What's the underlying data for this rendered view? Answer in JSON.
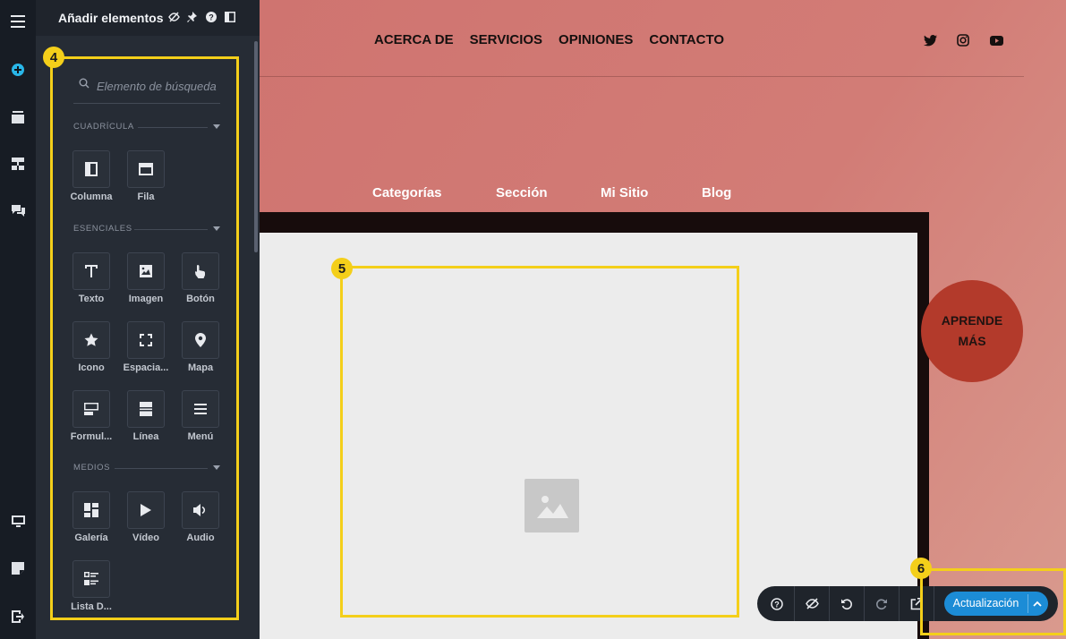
{
  "panel": {
    "title": "Añadir elementos",
    "search_placeholder": "Elemento de búsqueda",
    "sections": [
      {
        "label": "CUADRÍCULA",
        "items": [
          {
            "label": "Columna",
            "icon": "column-icon"
          },
          {
            "label": "Fila",
            "icon": "row-icon"
          }
        ]
      },
      {
        "label": "ESENCIALES",
        "items": [
          {
            "label": "Texto",
            "icon": "text-icon"
          },
          {
            "label": "Imagen",
            "icon": "image-icon"
          },
          {
            "label": "Botón",
            "icon": "pointer-hand-icon"
          },
          {
            "label": "Icono",
            "icon": "star-icon"
          },
          {
            "label": "Espacia...",
            "icon": "expand-icon"
          },
          {
            "label": "Mapa",
            "icon": "map-pin-icon"
          },
          {
            "label": "Formul...",
            "icon": "form-icon"
          },
          {
            "label": "Línea",
            "icon": "divider-icon"
          },
          {
            "label": "Menú",
            "icon": "menu-icon"
          }
        ]
      },
      {
        "label": "MEDIOS",
        "items": [
          {
            "label": "Galería",
            "icon": "gallery-icon"
          },
          {
            "label": "Vídeo",
            "icon": "play-icon"
          },
          {
            "label": "Audio",
            "icon": "speaker-icon"
          },
          {
            "label": "Lista D...",
            "icon": "list-icon"
          }
        ]
      }
    ]
  },
  "site": {
    "nav": [
      "ACERCA DE",
      "SERVICIOS",
      "OPINIONES",
      "CONTACTO"
    ],
    "social": [
      "twitter-icon",
      "instagram-icon",
      "youtube-icon"
    ],
    "subnav": [
      "Categorías",
      "Sección",
      "Mi Sitio",
      "Blog"
    ],
    "cta_line1": "APRENDE",
    "cta_line2": "MÁS"
  },
  "callouts": {
    "b4": "4",
    "b5": "5",
    "b6": "6"
  },
  "toolbar": {
    "update_label": "Actualización"
  },
  "colors": {
    "rail": "#171c24",
    "panel": "#262c35",
    "highlight": "#f4cf1a",
    "accent_blue": "#1c8cd6",
    "cta_red": "#b33a2b",
    "site_bg": "#d17a74"
  }
}
